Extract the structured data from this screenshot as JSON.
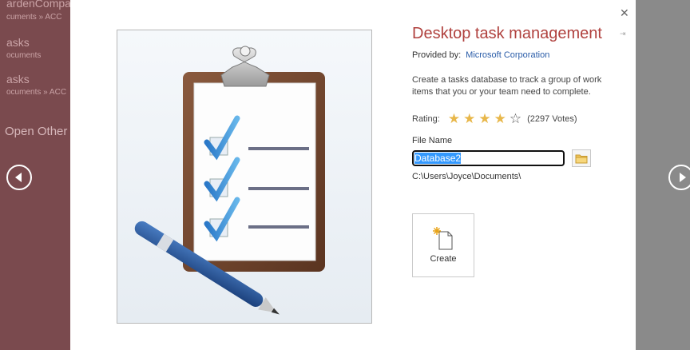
{
  "backstage": {
    "recent": [
      {
        "name": "ardenCompa",
        "path": "cuments » ACC"
      },
      {
        "name": "asks",
        "path": "ocuments"
      },
      {
        "name": "asks",
        "path": "ocuments » ACC"
      }
    ],
    "open_other": "Open Other"
  },
  "template": {
    "title": "Desktop task management",
    "provided_by_label": "Provided by:",
    "provider": "Microsoft Corporation",
    "description": "Create a tasks database to track a group of work items that you or your team need to complete.",
    "rating_label": "Rating:",
    "rating_value": 4,
    "rating_max": 5,
    "votes": "(2297 Votes)",
    "file_name_label": "File Name",
    "file_name_value": "Database2",
    "path": "C:\\Users\\Joyce\\Documents\\",
    "create_label": "Create"
  },
  "icons": {
    "close": "close-icon",
    "pin": "pin-icon",
    "prev": "arrow-left-icon",
    "next": "arrow-right-icon",
    "browse": "folder-icon",
    "create": "new-document-icon",
    "preview": "clipboard-checklist-icon"
  },
  "colors": {
    "sidebar": "#7a4a4e",
    "title": "#b0413e",
    "link": "#2a5ca8",
    "star": "#e8b74a",
    "overlay": "#8a8a8a"
  }
}
